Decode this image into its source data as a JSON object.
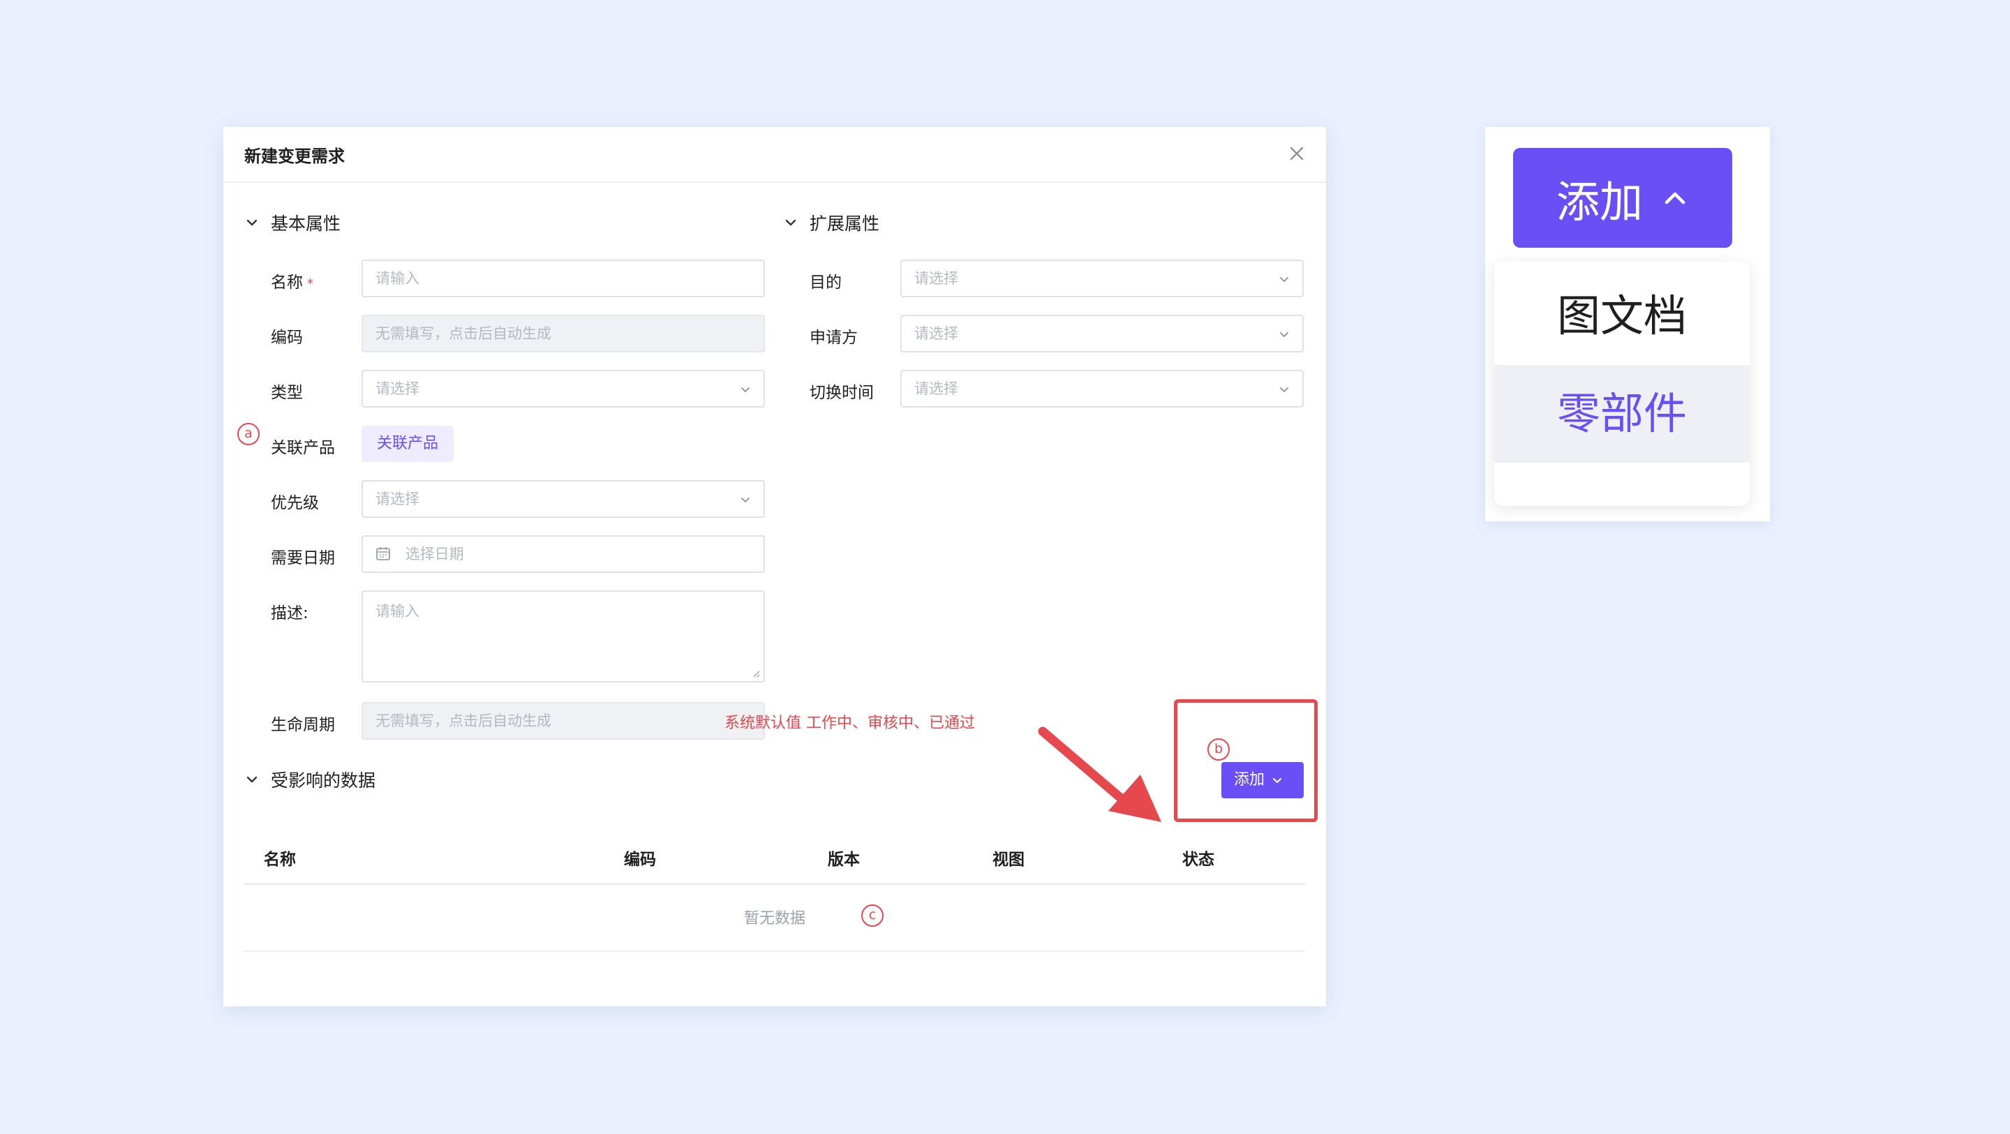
{
  "dialog": {
    "title": "新建变更需求"
  },
  "basic": {
    "title": "基本属性",
    "name_label": "名称",
    "name_required": "*",
    "name_placeholder": "请输入",
    "code_label": "编码",
    "code_placeholder": "无需填写，点击后自动生成",
    "type_label": "类型",
    "type_placeholder": "请选择",
    "product_label": "关联产品",
    "product_button": "关联产品",
    "priority_label": "优先级",
    "priority_placeholder": "请选择",
    "date_label": "需要日期",
    "date_placeholder": "选择日期",
    "desc_label": "描述:",
    "desc_placeholder": "请输入",
    "lifecycle_label": "生命周期",
    "lifecycle_placeholder": "无需填写，点击后自动生成"
  },
  "extended": {
    "title": "扩展属性",
    "purpose_label": "目的",
    "purpose_placeholder": "请选择",
    "applicant_label": "申请方",
    "applicant_placeholder": "请选择",
    "switch_label": "切换时间",
    "switch_placeholder": "请选择"
  },
  "affected": {
    "title": "受影响的数据",
    "add_button": "添加",
    "columns": [
      "名称",
      "编码",
      "版本",
      "视图",
      "状态"
    ],
    "empty_text": "暂无数据"
  },
  "annotations": {
    "a": "a",
    "b": "b",
    "c": "c",
    "lifecycle_note": "系统默认值 工作中、审核中、已通过",
    "color": "#e5484d"
  },
  "zoom": {
    "button_label": "添加",
    "menu_items": [
      "图文档",
      "零部件"
    ]
  },
  "colors": {
    "accent": "#6a4ff5",
    "annotation": "#e5484d",
    "background": "#eaf0fe"
  },
  "icons": {
    "close": "close-icon",
    "chevron": "chevron-down-icon",
    "calendar": "calendar-icon",
    "arrow": "red-arrow-icon"
  }
}
